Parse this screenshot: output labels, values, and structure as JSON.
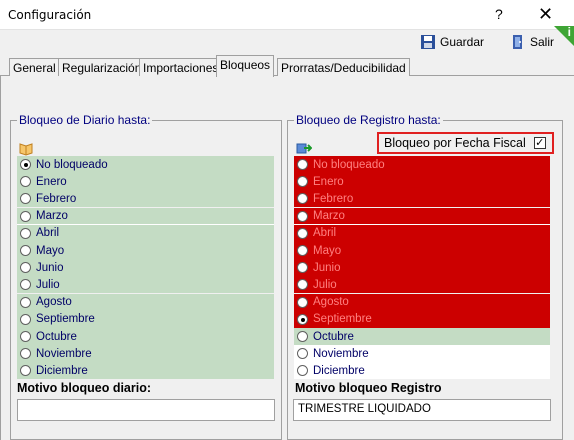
{
  "window": {
    "title": "Configuración",
    "help_label": "?",
    "close_label": "✕"
  },
  "toolbar": {
    "save_label": "Guardar",
    "exit_label": "Salir",
    "info_label": "i"
  },
  "tabs": [
    {
      "label": "General"
    },
    {
      "label": "Regularización"
    },
    {
      "label": "Importaciones"
    },
    {
      "label": "Bloqueos"
    },
    {
      "label": "Prorratas/Deducibilidad"
    }
  ],
  "diario": {
    "legend": "Bloqueo de Diario hasta:",
    "options": [
      {
        "label": "No bloqueado",
        "checked": true
      },
      {
        "label": "Enero",
        "checked": false
      },
      {
        "label": "Febrero",
        "checked": false
      },
      {
        "label": "Marzo",
        "checked": false
      },
      {
        "label": "Abril",
        "checked": false
      },
      {
        "label": "Mayo",
        "checked": false
      },
      {
        "label": "Junio",
        "checked": false
      },
      {
        "label": "Julio",
        "checked": false
      },
      {
        "label": "Agosto",
        "checked": false
      },
      {
        "label": "Septiembre",
        "checked": false
      },
      {
        "label": "Octubre",
        "checked": false
      },
      {
        "label": "Noviembre",
        "checked": false
      },
      {
        "label": "Diciembre",
        "checked": false
      }
    ],
    "motivo_label": "Motivo bloqueo diario:",
    "motivo_value": ""
  },
  "registro": {
    "legend": "Bloqueo de Registro hasta:",
    "fiscal_label": "Bloqueo por Fecha Fiscal",
    "fiscal_checked": true,
    "options": [
      {
        "label": "No bloqueado",
        "checked": false,
        "state": "red"
      },
      {
        "label": "Enero",
        "checked": false,
        "state": "red"
      },
      {
        "label": "Febrero",
        "checked": false,
        "state": "red"
      },
      {
        "label": "Marzo",
        "checked": false,
        "state": "red"
      },
      {
        "label": "Abril",
        "checked": false,
        "state": "red"
      },
      {
        "label": "Mayo",
        "checked": false,
        "state": "red"
      },
      {
        "label": "Junio",
        "checked": false,
        "state": "red"
      },
      {
        "label": "Julio",
        "checked": false,
        "state": "red"
      },
      {
        "label": "Agosto",
        "checked": false,
        "state": "red"
      },
      {
        "label": "Septiembre",
        "checked": true,
        "state": "red"
      },
      {
        "label": "Octubre",
        "checked": false,
        "state": "green"
      },
      {
        "label": "Noviembre",
        "checked": false,
        "state": "white"
      },
      {
        "label": "Diciembre",
        "checked": false,
        "state": "white"
      }
    ],
    "motivo_label": "Motivo bloqueo Registro",
    "motivo_value": "TRIMESTRE LIQUIDADO"
  },
  "colors": {
    "locked": "#cc0000",
    "unlocked": "#c4dcc4",
    "highlight_border": "#e02020"
  }
}
